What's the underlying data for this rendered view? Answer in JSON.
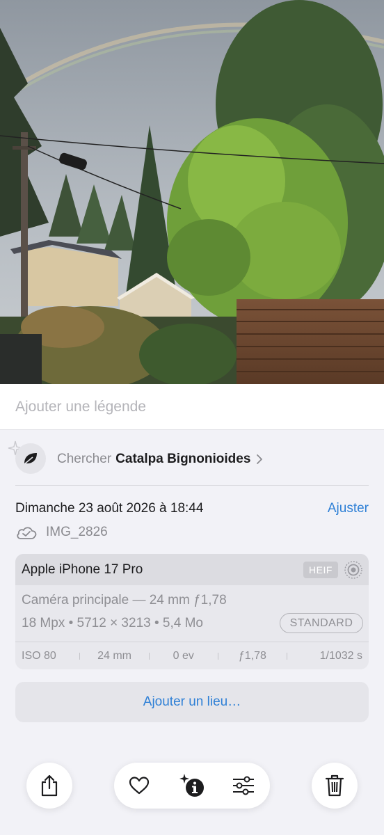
{
  "caption": {
    "placeholder": "Ajouter une légende"
  },
  "visual_lookup": {
    "prefix": "Chercher",
    "name": "Catalpa Bignonioides"
  },
  "info": {
    "date": "Dimanche 23 août 2026 à 18:44",
    "adjust_label": "Ajuster",
    "file_name": "IMG_2826"
  },
  "metadata": {
    "device": "Apple iPhone 17 Pro",
    "format_badge": "HEIF",
    "camera_line": "Caméra principale — 24 mm ƒ1,78",
    "resolution_line": "18 Mpx • 5712 × 3213 • 5,4 Mo",
    "style_badge": "STANDARD",
    "exif": {
      "iso": "ISO 80",
      "focal": "24 mm",
      "exposure": "0 ev",
      "aperture": "ƒ1,78",
      "shutter": "1/1032 s"
    }
  },
  "location": {
    "label": "Ajouter un lieu…"
  },
  "colors": {
    "accent": "#2f80d6",
    "background": "#f2f2f7",
    "card": "#e8e8ed"
  },
  "icons": [
    "share-icon",
    "heart-icon",
    "info-sparkle-icon",
    "adjust-sliders-icon",
    "trash-icon",
    "leaf-icon",
    "cloud-check-icon",
    "live-photo-icon",
    "chevron-right-icon",
    "sparkle-icon"
  ]
}
